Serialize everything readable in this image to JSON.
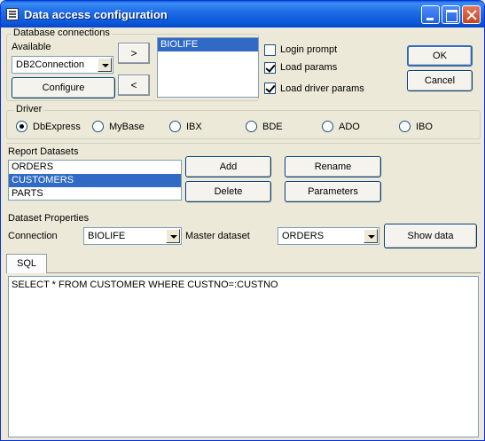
{
  "window": {
    "title": "Data access configuration"
  },
  "db_connections": {
    "group_label": "Database connections",
    "available_label": "Available",
    "selected_connection": "DB2Connection",
    "configure_label": "Configure",
    "add_arrow": ">",
    "remove_arrow": "<",
    "connections": [
      "BIOLIFE"
    ],
    "login_prompt_label": "Login prompt",
    "login_prompt_checked": false,
    "load_params_label": "Load params",
    "load_params_checked": true,
    "load_driver_params_label": "Load driver params",
    "load_driver_params_checked": true
  },
  "buttons": {
    "ok": "OK",
    "cancel": "Cancel"
  },
  "driver": {
    "group_label": "Driver",
    "options": [
      "DbExpress",
      "MyBase",
      "IBX",
      "BDE",
      "ADO",
      "IBO"
    ],
    "selected": "DbExpress"
  },
  "report_datasets": {
    "label": "Report Datasets",
    "items": [
      "ORDERS",
      "CUSTOMERS",
      "PARTS"
    ],
    "selected": "CUSTOMERS",
    "add_label": "Add",
    "delete_label": "Delete",
    "rename_label": "Rename",
    "parameters_label": "Parameters"
  },
  "dataset_properties": {
    "label": "Dataset Properties",
    "connection_label": "Connection",
    "connection_value": "BIOLIFE",
    "master_label": "Master dataset",
    "master_value": "ORDERS",
    "show_data_label": "Show data"
  },
  "sql": {
    "tab_label": "SQL",
    "text": "SELECT * FROM CUSTOMER WHERE CUSTNO=:CUSTNO"
  },
  "colors": {
    "title_bar": "#0a56d8",
    "selection": "#316ac5",
    "face": "#ece9d8"
  }
}
